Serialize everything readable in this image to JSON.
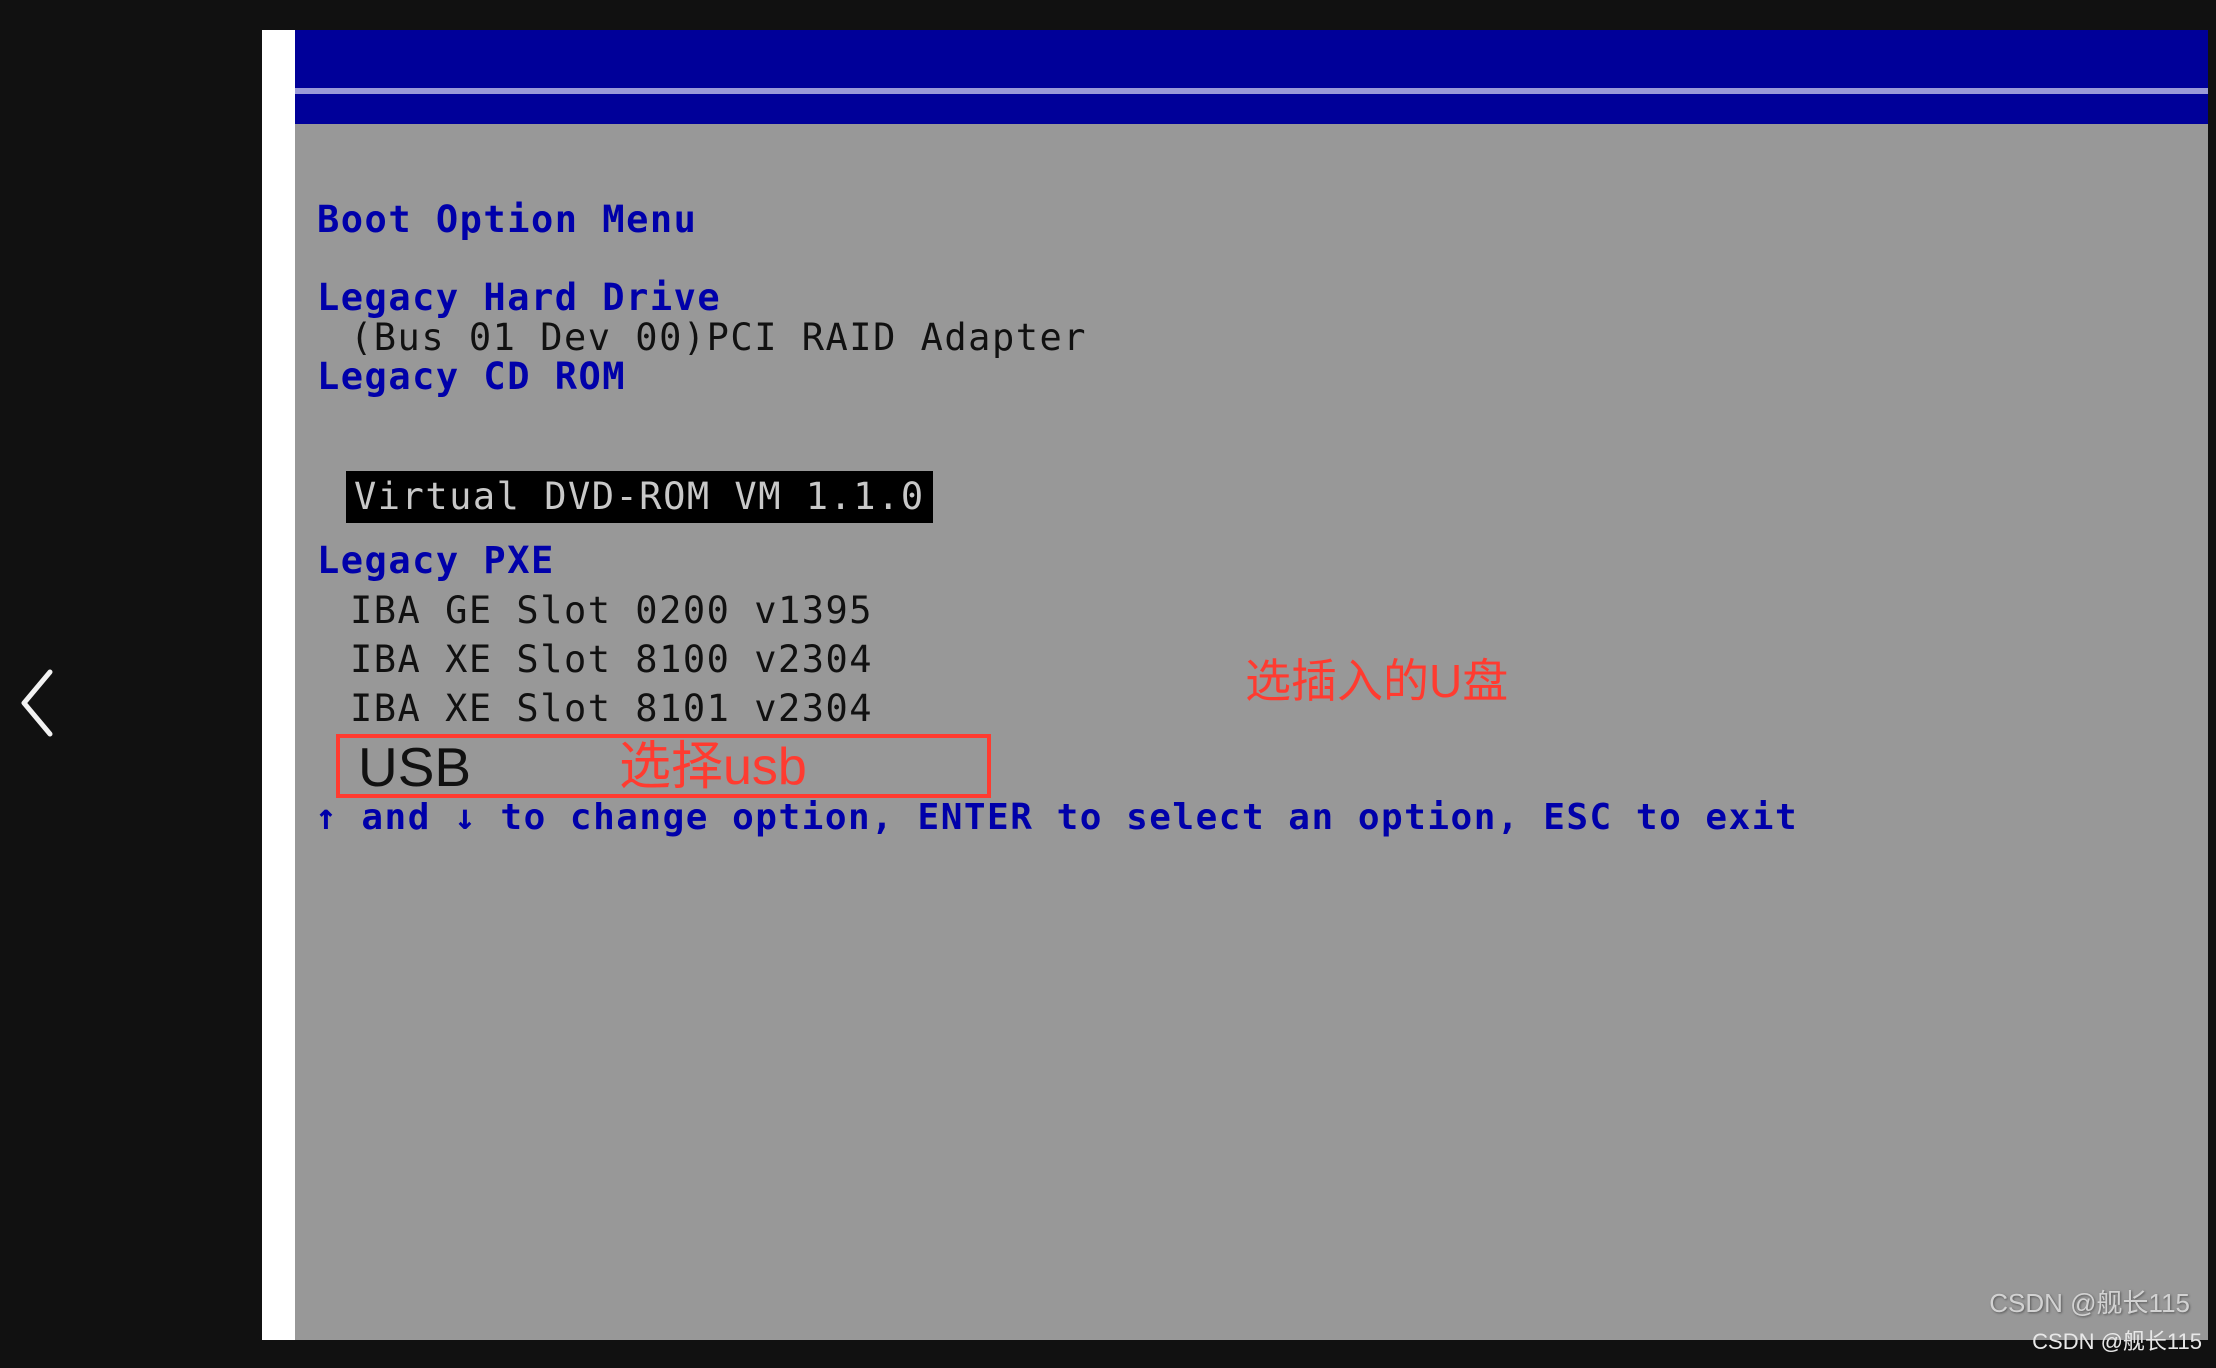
{
  "page": {
    "background_color": "#111111",
    "nav_prev_icon": "chevron-left-icon"
  },
  "bios": {
    "background_color": "#989898",
    "banner_color": "#000099",
    "heading_color": "#0000aa",
    "title": "Boot Option Menu",
    "groups": [
      {
        "label": "Legacy Hard Drive",
        "items": [
          {
            "label": "(Bus 01 Dev 00)PCI RAID Adapter",
            "selected": false
          }
        ]
      },
      {
        "label": "Legacy CD ROM",
        "items": [
          {
            "label": "Virtual DVD-ROM VM 1.1.0",
            "selected": true
          }
        ]
      },
      {
        "label": "Legacy PXE",
        "items": [
          {
            "label": "IBA GE Slot 0200 v1395",
            "selected": false
          },
          {
            "label": "IBA XE Slot 8100 v2304",
            "selected": false
          },
          {
            "label": "IBA XE Slot 8101 v2304",
            "selected": false
          }
        ]
      }
    ],
    "help_line": "↑ and ↓ to change option, ENTER to select an option, ESC to exit"
  },
  "annotations": {
    "accent_color": "#ff3b30",
    "usb_entry": "USB",
    "usb_callout": "选择usb",
    "udisk_callout": "选插入的U盘"
  },
  "watermarks": {
    "inner": "CSDN @舰长115",
    "outer": "CSDN @舰长115"
  }
}
